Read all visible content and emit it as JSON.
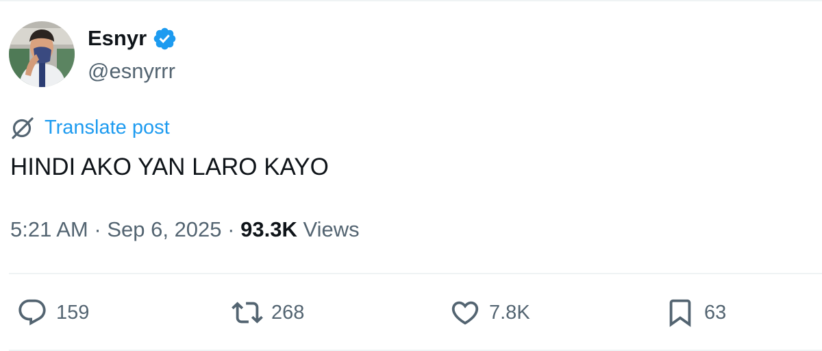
{
  "author": {
    "display_name": "Esnyr",
    "handle": "@esnyrrr",
    "verified": true,
    "verified_color": "#1d9bf0"
  },
  "translate": {
    "label": "Translate post",
    "icon": "translate-icon",
    "color": "#1d9bf0"
  },
  "post": {
    "text": "HINDI AKO YAN LARO KAYO"
  },
  "meta": {
    "time": "5:21 AM",
    "separator": "·",
    "date": "Sep 6, 2025",
    "views_count": "93.3K",
    "views_label": "Views"
  },
  "actions": {
    "replies": {
      "icon": "reply-icon",
      "count": "159"
    },
    "reposts": {
      "icon": "repost-icon",
      "count": "268"
    },
    "likes": {
      "icon": "heart-icon",
      "count": "7.8K"
    },
    "bookmarks": {
      "icon": "bookmark-icon",
      "count": "63"
    }
  },
  "colors": {
    "text": "#0f1419",
    "secondary": "#536471",
    "accent": "#1d9bf0",
    "divider": "#eff3f4"
  }
}
